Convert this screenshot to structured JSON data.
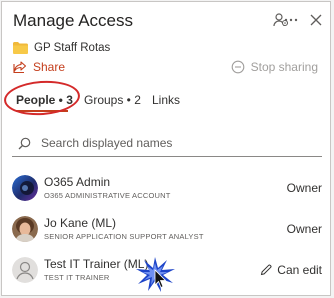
{
  "header": {
    "title": "Manage Access",
    "icons": [
      "manage-people-icon",
      "more-options-icon",
      "close-icon"
    ]
  },
  "item": {
    "name": "GP Staff Rotas",
    "icon": "folder-icon"
  },
  "actions": {
    "share": "Share",
    "stop_sharing": "Stop sharing"
  },
  "tabs": [
    {
      "label": "People • 3",
      "selected": true
    },
    {
      "label": "Groups • 2",
      "selected": false
    },
    {
      "label": "Links",
      "selected": false
    }
  ],
  "search": {
    "placeholder": "Search displayed names",
    "value": ""
  },
  "people": [
    {
      "name": "O365 Admin",
      "subtitle": "O365 ADMINISTRATIVE ACCOUNT",
      "role": "Owner"
    },
    {
      "name": "Jo Kane (ML)",
      "subtitle": "SENIOR APPLICATION SUPPORT ANALYST",
      "role": "Owner"
    },
    {
      "name": "Test IT Trainer (ML)",
      "subtitle": "TEST IT TRAINER",
      "role": "Can edit"
    }
  ],
  "colors": {
    "accent": "#c43e1c",
    "highlight_ring": "#d42a2a",
    "text": "#323130",
    "muted": "#605e5c"
  }
}
